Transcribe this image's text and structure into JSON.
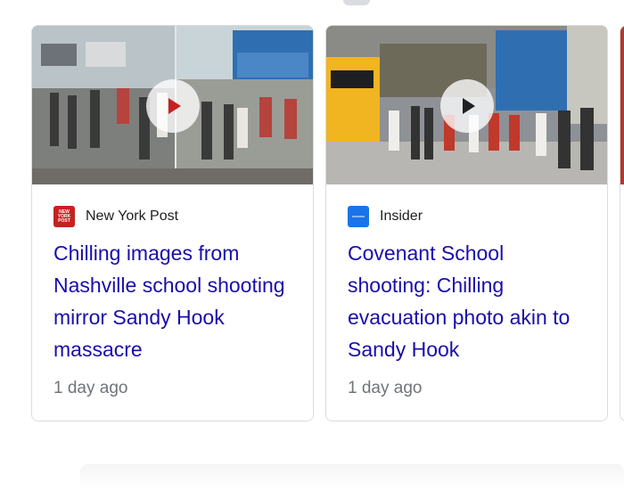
{
  "cards": [
    {
      "source": "New York Post",
      "favicon_text": "NEW YORK POST",
      "favicon_color": "#c5221f",
      "headline": "Chilling images from Nashville school shooting mirror Sandy Hook massacre",
      "age": "1 day ago",
      "thumbnail_icon": "play-icon"
    },
    {
      "source": "Insider",
      "favicon_color": "#1a73e8",
      "headline": "Covenant School shooting: Chilling evacuation photo akin to Sandy Hook",
      "age": "1 day ago",
      "thumbnail_icon": "play-icon"
    }
  ],
  "colors": {
    "link": "#1a0dab",
    "meta": "#70757a",
    "border": "#dadce0"
  }
}
